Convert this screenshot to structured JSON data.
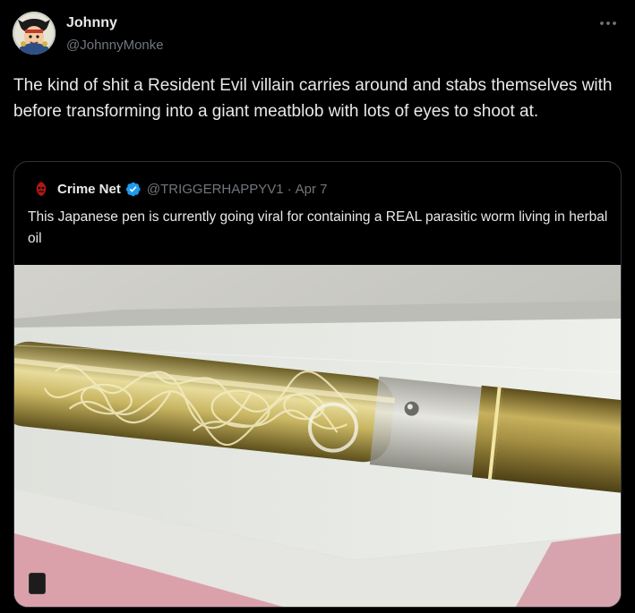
{
  "tweet": {
    "author_name": "Johnny",
    "author_handle": "@JohnnyMonke",
    "text": "The kind of shit a Resident Evil villain carries around and stabs themselves with before transforming into a giant meatblob with lots of eyes to shoot at.",
    "more_icon": "more-horizontal-icon"
  },
  "quoted_tweet": {
    "author_name": "Crime Net",
    "verified_icon": "verified-badge-icon",
    "author_handle": "@TRIGGERHAPPYV1",
    "separator": "·",
    "date": "Apr 7",
    "text": "This Japanese pen is currently going viral for containing a REAL parasitic worm living in herbal oil"
  },
  "colors": {
    "background": "#000000",
    "text_primary": "#e7e9ea",
    "text_secondary": "#71767b",
    "border": "#2f3336",
    "verified_blue": "#1d9bf0",
    "pen_gold": "#a9954a"
  }
}
